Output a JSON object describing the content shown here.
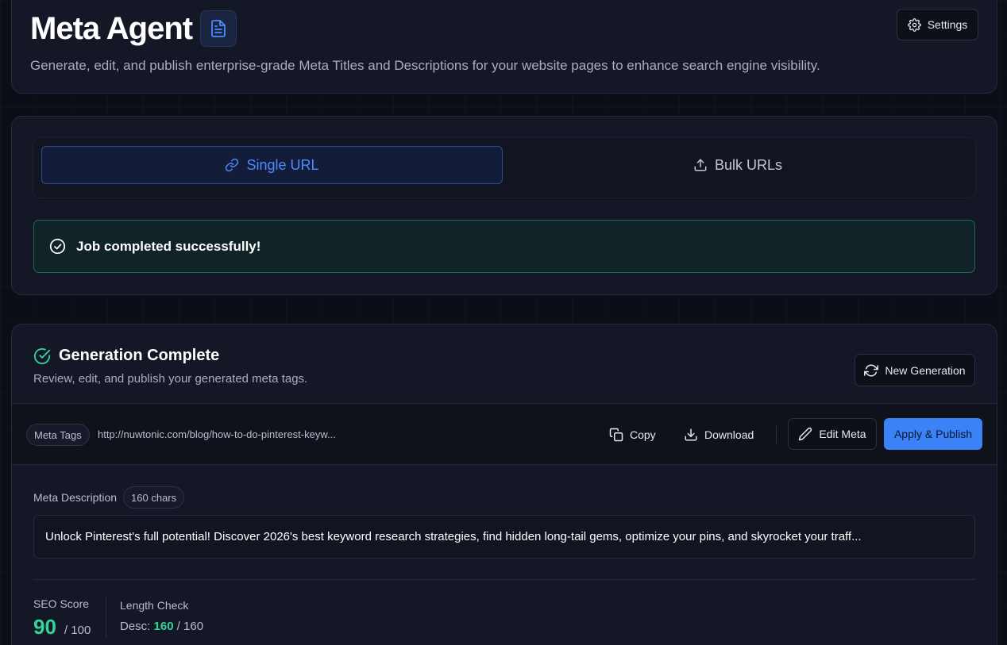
{
  "header": {
    "title": "Meta Agent",
    "subtitle": "Generate, edit, and publish enterprise-grade Meta Titles and Descriptions for your website pages to enhance search engine visibility.",
    "settings_label": "Settings",
    "title_icon": "document-icon",
    "settings_icon": "gear-icon"
  },
  "mode": {
    "tabs": [
      {
        "label": "Single URL",
        "icon": "link-icon",
        "active": true
      },
      {
        "label": "Bulk URLs",
        "icon": "upload-icon",
        "active": false
      }
    ],
    "status_message": "Job completed successfully!",
    "status_icon": "check-circle-icon"
  },
  "results": {
    "title": "Generation Complete",
    "subtitle": "Review, edit, and publish your generated meta tags.",
    "new_generation_label": "New Generation",
    "toolbar": {
      "tag_label": "Meta Tags",
      "url": "http://nuwtonic.com/blog/how-to-do-pinterest-keyw...",
      "copy_label": "Copy",
      "download_label": "Download",
      "edit_label": "Edit Meta",
      "publish_label": "Apply & Publish"
    },
    "description": {
      "label": "Meta Description",
      "chars_badge": "160 chars",
      "text": "Unlock Pinterest's full potential! Discover 2026's best keyword research strategies, find hidden long-tail gems, optimize your pins, and skyrocket your traff..."
    },
    "stats": {
      "seo_label": "SEO Score",
      "seo_score": "90",
      "seo_max": "/ 100",
      "length_label": "Length Check",
      "desc_prefix": "Desc:",
      "desc_value": "160",
      "desc_max": "/ 160"
    }
  },
  "colors": {
    "accent": "#3b82f6",
    "success": "#34d399",
    "background": "#0b0d17",
    "card": "#141726"
  }
}
